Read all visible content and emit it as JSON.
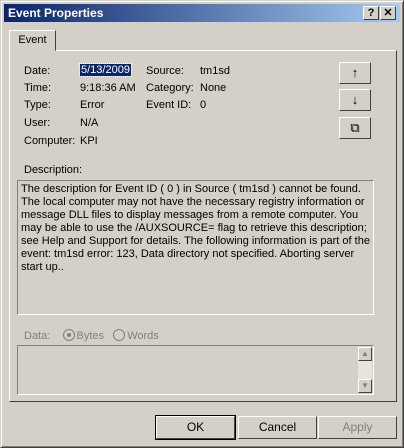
{
  "window": {
    "title": "Event Properties",
    "help_glyph": "?",
    "close_glyph": "✕"
  },
  "tab": {
    "label": "Event"
  },
  "fields": {
    "date_label": "Date:",
    "date_value": "5/13/2009",
    "time_label": "Time:",
    "time_value": "9:18:36 AM",
    "type_label": "Type:",
    "type_value": "Error",
    "user_label": "User:",
    "user_value": "N/A",
    "computer_label": "Computer:",
    "computer_value": "KPI",
    "source_label": "Source:",
    "source_value": "tm1sd",
    "category_label": "Category:",
    "category_value": "None",
    "eventid_label": "Event ID:",
    "eventid_value": "0"
  },
  "side_buttons": {
    "up": "↑",
    "down": "↓",
    "copy": "⧉"
  },
  "description": {
    "label": "Description:",
    "text": "The description for Event ID ( 0 ) in Source ( tm1sd ) cannot be found. The local computer may not have the necessary registry information or message DLL files to display messages from a remote computer. You may be able to use the /AUXSOURCE= flag to retrieve this description; see Help and Support for details. The following information is part of the event: tm1sd error: 123, Data directory not specified. Aborting server start up.."
  },
  "data_section": {
    "label": "Data:",
    "bytes": "Bytes",
    "words": "Words"
  },
  "buttons": {
    "ok": "OK",
    "cancel": "Cancel",
    "apply": "Apply"
  }
}
